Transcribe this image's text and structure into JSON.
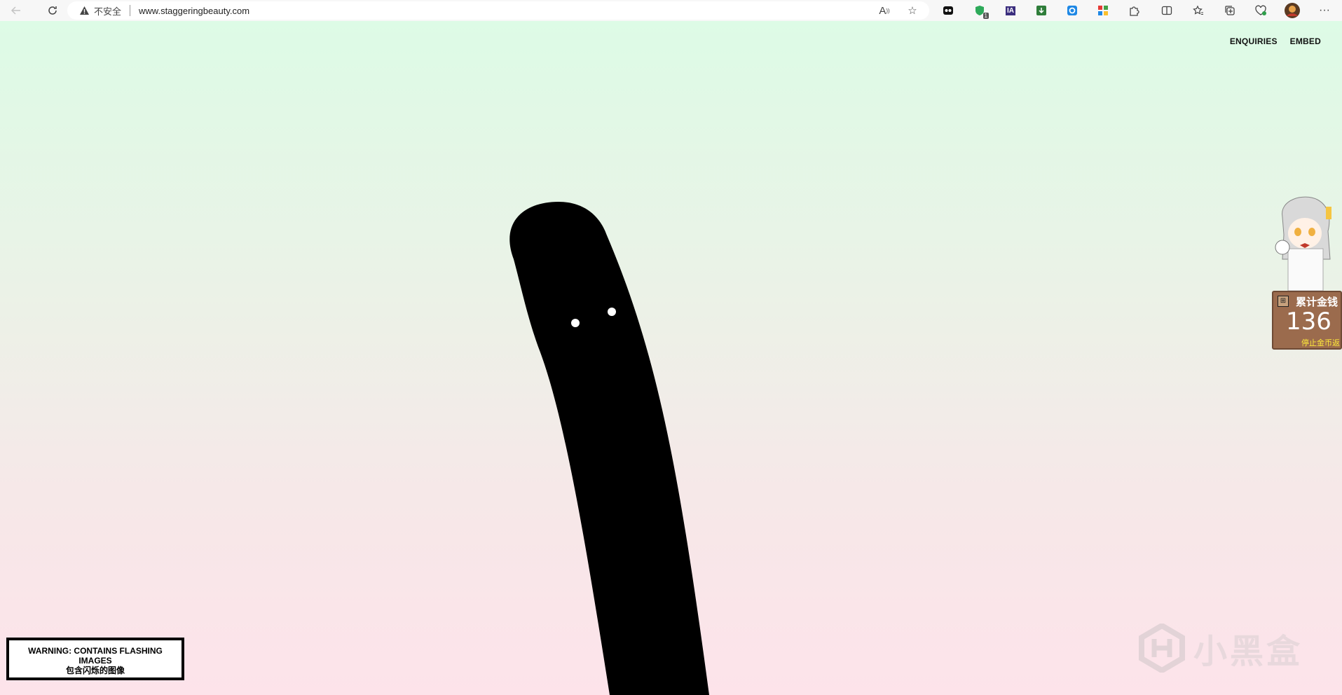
{
  "browser": {
    "insecure_label": "不安全",
    "url": "www.staggeringbeauty.com",
    "extension_badge": "1",
    "ia_label": "IA"
  },
  "nav": {
    "enquiries": "ENQUIRIES",
    "embed": "EMBED"
  },
  "warning": {
    "line1": "WARNING: CONTAINS FLASHING",
    "line2": "IMAGES",
    "line3": "包含闪烁的图像"
  },
  "widget": {
    "title": "累计金钱",
    "value": "136",
    "subtitle": "停止金币返"
  },
  "watermark": {
    "text": "小黑盒"
  },
  "colors": {
    "gradient_top": "#ddfbe6",
    "gradient_bottom": "#fde3ea",
    "creature": "#000000"
  }
}
